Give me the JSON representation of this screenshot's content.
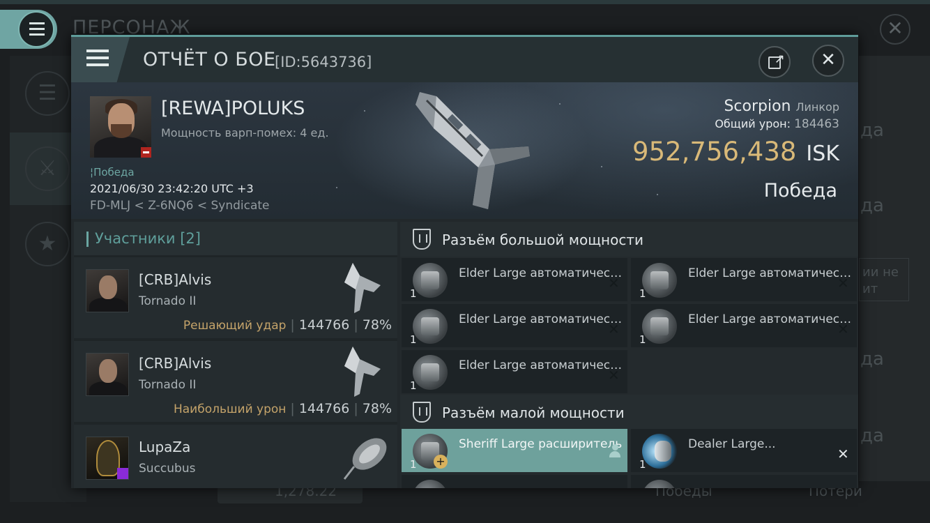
{
  "background": {
    "title": "ПЕРСОНАЖ",
    "right_labels": [
      "да",
      "да",
      "да",
      "да"
    ],
    "right_box_text": "ии не ит",
    "bottom_value": "1,278.22",
    "bottom_wins": "Победы",
    "bottom_losses": "Потери"
  },
  "modal": {
    "title": "ОТЧЁТ О БОЕ",
    "report_id": "[ID:5643736]",
    "icons": {
      "menu": "hamburger-icon",
      "share": "share-icon",
      "close": "close-icon"
    }
  },
  "victim": {
    "name": "[REWA]POLUKS",
    "warp_strength": "Мощность варп-помех: 4 ед.",
    "tag": "Победа",
    "datetime": "2021/06/30 23:42:20 UTC +3",
    "location": "FD-MLJ < Z-6NQ6 < Syndicate",
    "ship_name": "Scorpion",
    "ship_class": "Линкор",
    "total_damage_label": "Общий урон:",
    "total_damage": "184463",
    "isk_value": "952,756,438",
    "isk_unit": "ISK",
    "result": "Победа"
  },
  "participants": {
    "header": "Участники [2]",
    "rows": [
      {
        "name": "[CRB]Alvis",
        "ship": "Tornado II",
        "role": "Решающий удар",
        "damage": "144766",
        "percent": "78%"
      },
      {
        "name": "[CRB]Alvis",
        "ship": "Tornado II",
        "role": "Наибольший урон",
        "damage": "144766",
        "percent": "78%"
      },
      {
        "name": "LupaZa",
        "ship": "Succubus",
        "role": "",
        "damage": "",
        "percent": ""
      }
    ]
  },
  "modules": {
    "high_slots_title": "Разъём большой мощности",
    "mid_slots_title": "Разъём малой мощности",
    "high": [
      {
        "name": "Elder Large автоматическая",
        "qty": "1"
      },
      {
        "name": "Elder Large автоматическая",
        "qty": "1"
      },
      {
        "name": "Elder Large автоматическая",
        "qty": "1"
      },
      {
        "name": "Elder Large автоматическая",
        "qty": "1"
      },
      {
        "name": "Elder Large автоматическая",
        "qty": "1"
      }
    ],
    "mid": [
      {
        "name": "Sheriff Large расширитель",
        "qty": "1"
      },
      {
        "name": "Dealer Large...",
        "qty": "1"
      }
    ]
  },
  "colors": {
    "accent_teal": "#6ea19c",
    "isk_gold": "#d9b978",
    "role_gold": "#c5a46a",
    "loss_red": "#b0251f"
  }
}
